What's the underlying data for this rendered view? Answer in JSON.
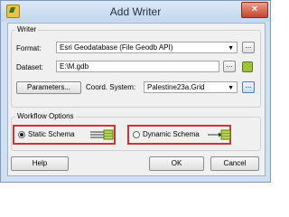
{
  "window": {
    "title": "Add Writer",
    "close_glyph": "×"
  },
  "writer_group": {
    "label": "Writer",
    "format_label": "Format:",
    "format_value": "Esri Geodatabase (File Geodb API)",
    "dataset_label": "Dataset:",
    "dataset_value": "E:\\M.gdb",
    "parameters_button": "Parameters...",
    "coord_label": "Coord. System:",
    "coord_value": "Palestine23a.Grid",
    "more_glyph": "..."
  },
  "workflow_group": {
    "label": "Workflow Options",
    "static_schema": {
      "label": "Static Schema",
      "selected": true,
      "icon": "static-schema-icon"
    },
    "dynamic_schema": {
      "label": "Dynamic Schema",
      "selected": false,
      "icon": "dynamic-schema-icon"
    },
    "highlight_color": "#d3322e"
  },
  "footer": {
    "help": "Help",
    "ok": "OK",
    "cancel": "Cancel"
  }
}
